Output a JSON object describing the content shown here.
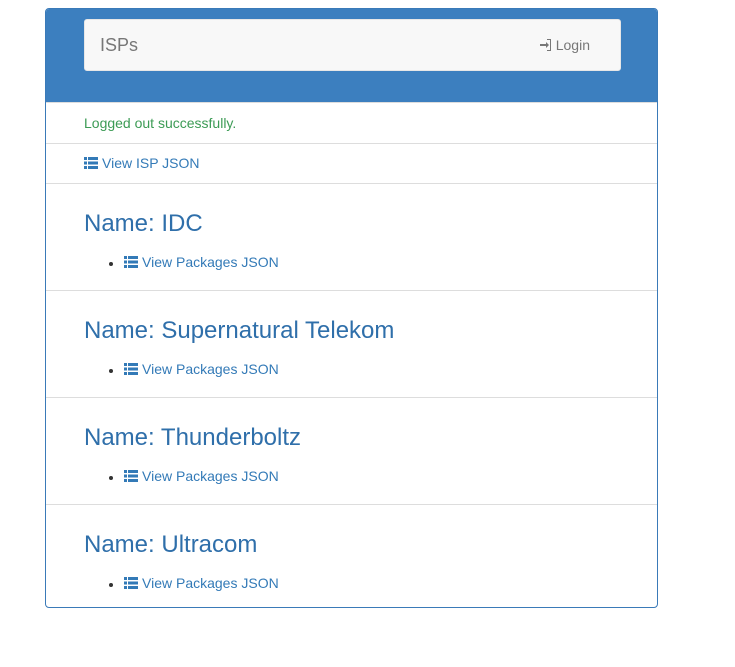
{
  "navbar": {
    "brand": "ISPs",
    "login_label": "Login"
  },
  "flash": {
    "message": "Logged out successfully."
  },
  "isp_json_link": {
    "label": "View ISP JSON"
  },
  "isps": [
    {
      "name": "Name: IDC",
      "link_label": "View Packages JSON"
    },
    {
      "name": "Name: Supernatural Telekom",
      "link_label": "View Packages JSON"
    },
    {
      "name": "Name: Thunderboltz",
      "link_label": "View Packages JSON"
    },
    {
      "name": "Name: Ultracom",
      "link_label": "View Packages JSON"
    }
  ],
  "colors": {
    "primary": "#3c7fbf",
    "link": "#337ab7",
    "success": "#3c9b55"
  },
  "icons": {
    "list": "list-icon",
    "login": "sign-in-icon"
  }
}
